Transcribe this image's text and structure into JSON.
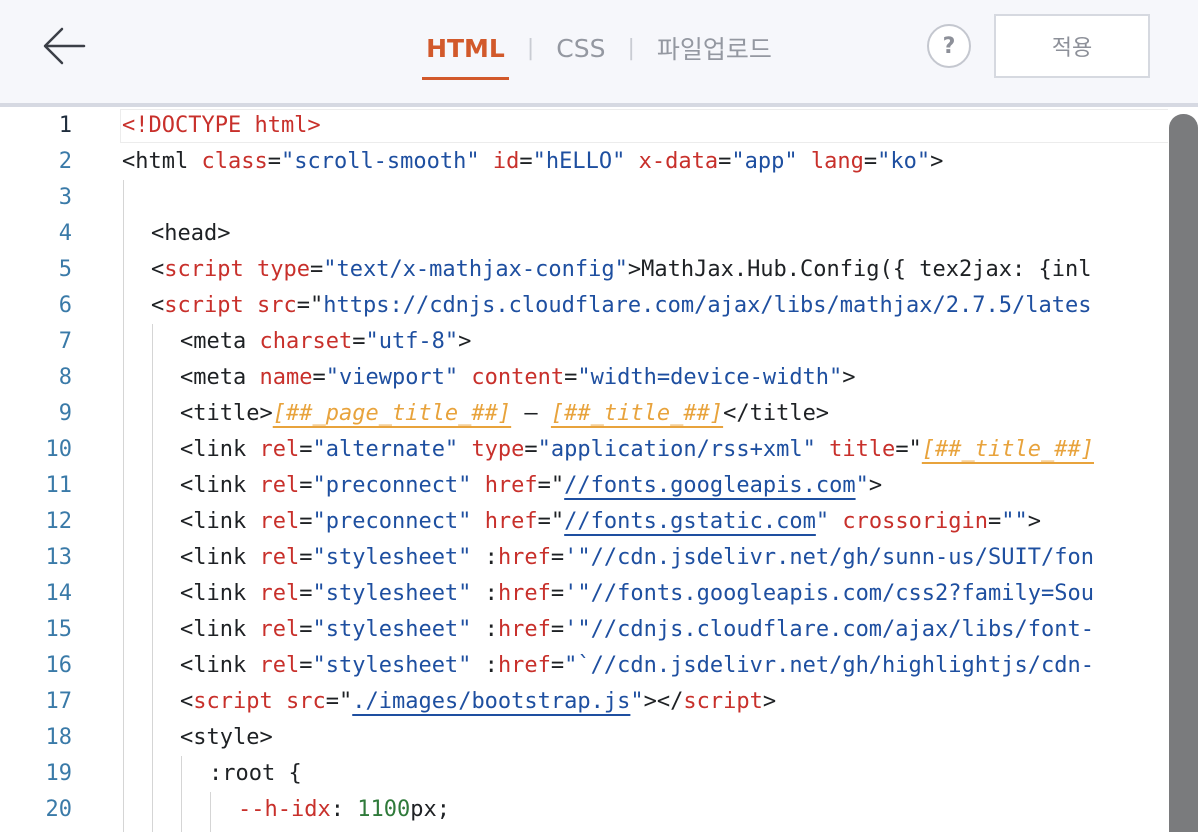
{
  "header": {
    "tabs": [
      {
        "label": "HTML",
        "active": true
      },
      {
        "label": "CSS",
        "active": false
      },
      {
        "label": "파일업로드",
        "active": false
      }
    ],
    "help_label": "?",
    "apply_label": "적용"
  },
  "colors": {
    "accent": "#d2592b",
    "tag": "#c8302b",
    "string": "#1e4fa0",
    "placeholder": "#e8a33c",
    "number": "#2f7a3a"
  },
  "editor": {
    "current_line": 1,
    "line_numbers": [
      "1",
      "2",
      "3",
      "4",
      "5",
      "6",
      "7",
      "8",
      "9",
      "10",
      "11",
      "12",
      "13",
      "14",
      "15",
      "16",
      "17",
      "18",
      "19",
      "20"
    ],
    "lines": [
      {
        "t": "<!DOCTYPE html>"
      },
      {
        "p": "<html ",
        "a1": "class",
        "e1": "=",
        "s1": "\"scroll-smooth\"",
        "sp1": " ",
        "a2": "id",
        "e2": "=",
        "s2": "\"hELLO\"",
        "sp2": " ",
        "a3": "x-data",
        "e3": "=",
        "s3": "\"app\"",
        "sp3": " ",
        "a4": "lang",
        "e4": "=",
        "s4": "\"ko\"",
        "c": ">"
      },
      {},
      {
        "p": "<head>"
      },
      {
        "p": "<script ",
        "a1": "type",
        "e1": "=",
        "s1": "\"text/x-mathjax-config\"",
        "c": ">MathJax.Hub.Config({ tex2jax: {inl"
      },
      {
        "p": "<script ",
        "a1": "src",
        "e1": "=\"",
        "s1": "https://cdnjs.cloudflare.com/ajax/libs/mathjax/2.7.5/lates"
      },
      {
        "p": "<meta ",
        "a1": "charset",
        "e1": "=",
        "s1": "\"utf-8\"",
        "c": ">"
      },
      {
        "p": "<meta ",
        "a1": "name",
        "e1": "=",
        "s1": "\"viewport\"",
        "sp1": " ",
        "a2": "content",
        "e2": "=",
        "s2": "\"width=device-width\"",
        "c": ">"
      },
      {
        "p": "<title>",
        "ph1": "[##_page_title_##]",
        "m": " – ",
        "ph2": "[##_title_##]",
        "c": "</title>"
      },
      {
        "p": "<link ",
        "a1": "rel",
        "e1": "=",
        "s1": "\"alternate\"",
        "sp1": " ",
        "a2": "type",
        "e2": "=",
        "s2": "\"application/rss+xml\"",
        "sp2": " ",
        "a3": "title",
        "e3": "=\"",
        "ph1": "[##_title_##]"
      },
      {
        "p": "<link ",
        "a1": "rel",
        "e1": "=",
        "s1": "\"preconnect\"",
        "sp1": " ",
        "a2": "href",
        "e2": "=\"",
        "u1": "//fonts.googleapis.com",
        "q": "\"",
        "c": ">"
      },
      {
        "p": "<link ",
        "a1": "rel",
        "e1": "=",
        "s1": "\"preconnect\"",
        "sp1": " ",
        "a2": "href",
        "e2": "=\"",
        "u1": "//fonts.gstatic.com",
        "q": "\"",
        "sp2": " ",
        "a3": "crossorigin",
        "e3": "=",
        "s3": "\"\"",
        "c": ">"
      },
      {
        "p": "<link ",
        "a1": "rel",
        "e1": "=",
        "s1": "\"stylesheet\"",
        "sp1": " :",
        "a2": "href",
        "e2": "=",
        "s2": "'\"//cdn.jsdelivr.net/gh/sunn-us/SUIT/fon"
      },
      {
        "p": "<link ",
        "a1": "rel",
        "e1": "=",
        "s1": "\"stylesheet\"",
        "sp1": " :",
        "a2": "href",
        "e2": "=",
        "s2": "'\"//fonts.googleapis.com/css2?family=Sou"
      },
      {
        "p": "<link ",
        "a1": "rel",
        "e1": "=",
        "s1": "\"stylesheet\"",
        "sp1": " :",
        "a2": "href",
        "e2": "=",
        "s2": "'\"//cdnjs.cloudflare.com/ajax/libs/font-"
      },
      {
        "p": "<link ",
        "a1": "rel",
        "e1": "=",
        "s1": "\"stylesheet\"",
        "sp1": " :",
        "a2": "href",
        "e2": "=",
        "s2": "\"`//cdn.jsdelivr.net/gh/highlightjs/cdn-"
      },
      {
        "p": "<",
        "t2": "script",
        "sp1": " ",
        "a1": "src",
        "e1": "=\"",
        "u1": "./images/bootstrap.js",
        "q": "\"",
        "c": "></",
        "t3": "script",
        "c2": ">"
      },
      {
        "p": "<style>"
      },
      {
        "p": ":root {"
      },
      {
        "a1": "--h-idx",
        "e1": ": ",
        "n1": "1100",
        "c": "px;"
      }
    ]
  }
}
